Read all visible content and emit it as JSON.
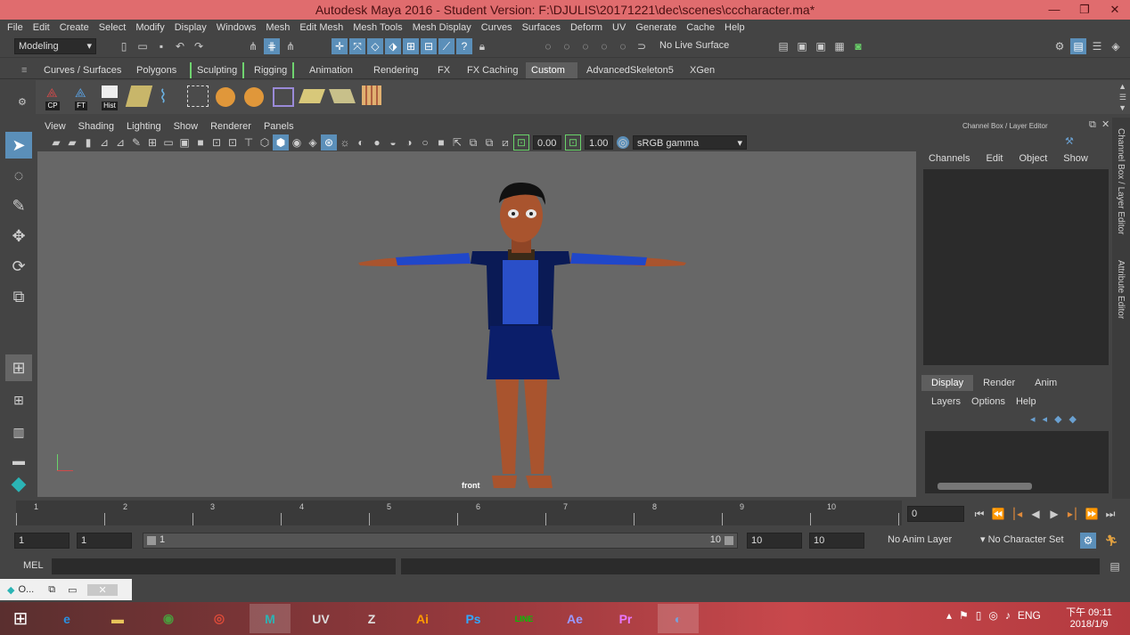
{
  "window": {
    "title": "Autodesk Maya 2016 - Student Version: F:\\DJULIS\\20171221\\dec\\scenes\\cccharacter.ma*",
    "min": "—",
    "max": "❐",
    "close": "✕"
  },
  "menu": [
    "File",
    "Edit",
    "Create",
    "Select",
    "Modify",
    "Display",
    "Windows",
    "Mesh",
    "Edit Mesh",
    "Mesh Tools",
    "Mesh Display",
    "Curves",
    "Surfaces",
    "Deform",
    "UV",
    "Generate",
    "Cache",
    "Help"
  ],
  "status_line": {
    "mode": "Modeling",
    "live_surface": "No Live Surface"
  },
  "shelf": {
    "tabs": [
      "Curves / Surfaces",
      "Polygons",
      "Sculpting",
      "Rigging",
      "Animation",
      "Rendering",
      "FX",
      "FX Caching",
      "Custom",
      "AdvancedSkeleton5",
      "XGen"
    ],
    "active_tab": "Custom",
    "buttons": [
      {
        "label": "CP",
        "icon": "cp-icon"
      },
      {
        "label": "FT",
        "icon": "ft-icon"
      },
      {
        "label": "Hist",
        "icon": "history-icon"
      }
    ]
  },
  "panel": {
    "menu": [
      "View",
      "Shading",
      "Lighting",
      "Show",
      "Renderer",
      "Panels"
    ],
    "exposure": "0.00",
    "gamma": "1.00",
    "color_space": "sRGB gamma",
    "camera_label": "front"
  },
  "channel_box": {
    "title": "Channel Box / Layer Editor",
    "menu": [
      "Channels",
      "Edit",
      "Object",
      "Show"
    ],
    "side_tab_1": "Channel Box / Layer Editor",
    "side_tab_2": "Attribute Editor"
  },
  "layer_editor": {
    "tabs": [
      "Display",
      "Render",
      "Anim"
    ],
    "active_tab": "Display",
    "menu": [
      "Layers",
      "Options",
      "Help"
    ]
  },
  "timeline": {
    "ticks": [
      "1",
      "2",
      "3",
      "4",
      "5",
      "6",
      "7",
      "8",
      "9",
      "10"
    ],
    "current_frame": "0"
  },
  "range": {
    "start": "1",
    "playback_start": "1",
    "slider_start": "1",
    "slider_end": "10",
    "playback_end": "10",
    "end": "10",
    "anim_layer": "No Anim Layer",
    "character_set": "No Character Set"
  },
  "command_line": {
    "label": "MEL"
  },
  "help_line": {
    "label": "O..."
  },
  "taskbar": {
    "apps": [
      {
        "name": "Internet Explorer",
        "icon": "ie-icon",
        "glyph": "e",
        "color": "#2a8fe0"
      },
      {
        "name": "File Explorer",
        "icon": "folder-icon",
        "glyph": "▬",
        "color": "#e8c35a"
      },
      {
        "name": "Google Earth",
        "icon": "globe-icon",
        "glyph": "◉",
        "color": "#4b9b3d"
      },
      {
        "name": "Chrome",
        "icon": "chrome-icon",
        "glyph": "◎",
        "color": "#dd4b39"
      },
      {
        "name": "Maya",
        "icon": "maya-icon",
        "glyph": "M",
        "color": "#2bb4b5"
      },
      {
        "name": "UV Layout",
        "icon": "uv-icon",
        "glyph": "UV",
        "color": "#dcdcdc"
      },
      {
        "name": "ZBrush",
        "icon": "zbrush-icon",
        "glyph": "Z",
        "color": "#e0e0e0"
      },
      {
        "name": "Illustrator",
        "icon": "ai-icon",
        "glyph": "Ai",
        "color": "#ff9a00"
      },
      {
        "name": "Photoshop",
        "icon": "ps-icon",
        "glyph": "Ps",
        "color": "#31a8ff"
      },
      {
        "name": "LINE",
        "icon": "line-icon",
        "glyph": "LINE",
        "color": "#00c300"
      },
      {
        "name": "After Effects",
        "icon": "ae-icon",
        "glyph": "Ae",
        "color": "#9999ff"
      },
      {
        "name": "Premiere",
        "icon": "pr-icon",
        "glyph": "Pr",
        "color": "#ea77ff"
      },
      {
        "name": "Paint",
        "icon": "palette-icon",
        "glyph": "◐",
        "color": "#7aa0d8"
      }
    ],
    "lang": "ENG",
    "time": "下午 09:11",
    "date": "2018/1/9"
  }
}
